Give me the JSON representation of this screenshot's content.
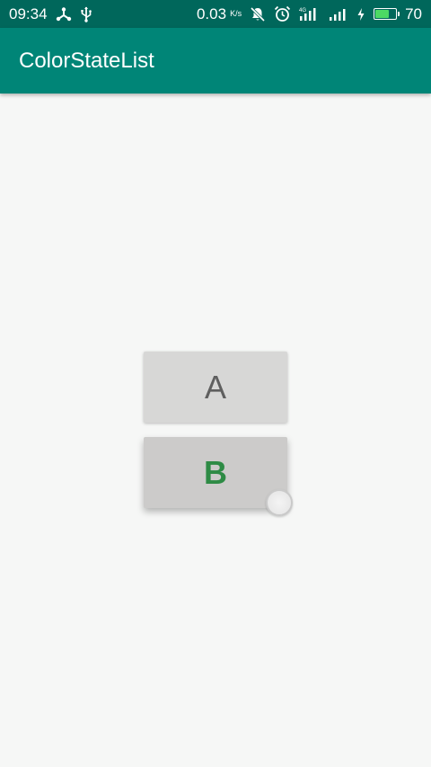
{
  "status_bar": {
    "time": "09:34",
    "network_speed": "0.03",
    "network_speed_unit": "K/s",
    "battery_level": "70",
    "battery_fraction": 0.7,
    "icons": [
      "share-icon",
      "usb-icon",
      "notifications-off-icon",
      "alarm-icon",
      "signal-4g-icon",
      "signal-icon",
      "charging-icon",
      "battery-icon"
    ]
  },
  "app_bar": {
    "title": "ColorStateList"
  },
  "buttons": {
    "a": {
      "label": "A",
      "text_color": "#5f5f5f"
    },
    "b": {
      "label": "B",
      "text_color": "#2e8b45"
    }
  },
  "colors": {
    "status_bar": "#00675b",
    "app_bar": "#008577",
    "background": "#f6f7f6",
    "button_a_bg": "#d7d7d6",
    "button_b_bg": "#cccbca"
  }
}
